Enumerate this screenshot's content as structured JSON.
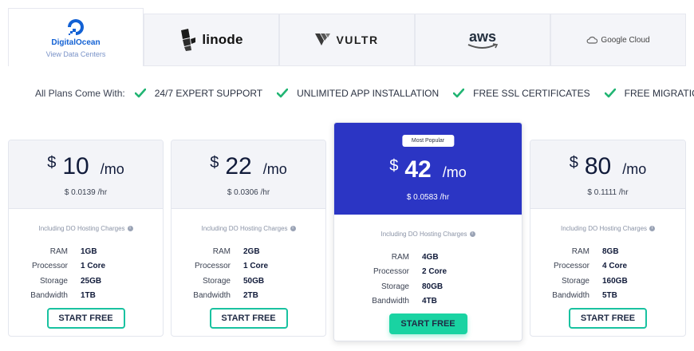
{
  "providers": [
    {
      "name": "DigitalOcean",
      "sub": "View Data Centers",
      "active": true
    },
    {
      "name": "linode",
      "active": false
    },
    {
      "name": "VULTR",
      "active": false
    },
    {
      "name": "aws",
      "active": false
    },
    {
      "name": "Google Cloud",
      "active": false
    }
  ],
  "features": {
    "lead": "All Plans Come With:",
    "items": [
      "24/7 EXPERT SUPPORT",
      "UNLIMITED APP INSTALLATION",
      "FREE SSL CERTIFICATES",
      "FREE MIGRATION"
    ],
    "check_color": "#21b573"
  },
  "plan_common": {
    "currency": "$",
    "period": "/mo",
    "including": "Including DO Hosting Charges",
    "spec_labels": [
      "RAM",
      "Processor",
      "Storage",
      "Bandwidth"
    ],
    "button": "START FREE"
  },
  "plans": [
    {
      "price": "10",
      "hourly": "$ 0.0139 /hr",
      "specs": [
        "1GB",
        "1 Core",
        "25GB",
        "1TB"
      ]
    },
    {
      "price": "22",
      "hourly": "$ 0.0306 /hr",
      "specs": [
        "2GB",
        "1 Core",
        "50GB",
        "2TB"
      ]
    },
    {
      "price": "42",
      "hourly": "$ 0.0583 /hr",
      "badge": "Most Popular",
      "specs": [
        "4GB",
        "2 Core",
        "80GB",
        "4TB"
      ]
    },
    {
      "price": "80",
      "hourly": "$ 0.1111 /hr",
      "specs": [
        "8GB",
        "4 Core",
        "160GB",
        "5TB"
      ]
    }
  ],
  "colors": {
    "accent": "#19c2a0",
    "popular_bg": "#2b35c4",
    "do_blue": "#1261d4"
  }
}
